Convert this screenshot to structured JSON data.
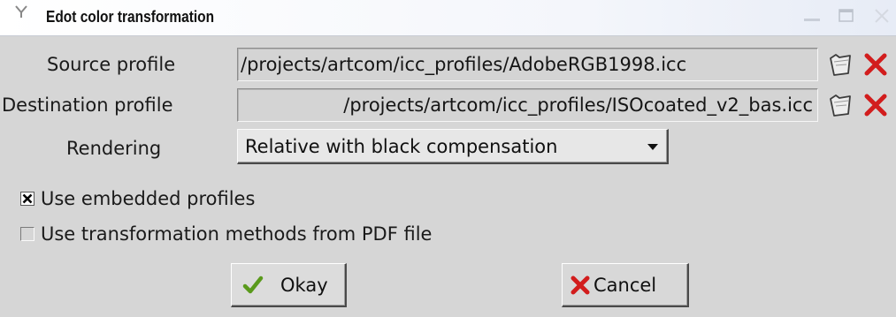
{
  "window": {
    "title": "Edot color transformation",
    "controls": [
      "window-menu-icon",
      "minimize-icon",
      "maximize-icon",
      "close-icon"
    ]
  },
  "source": {
    "label": "Source profile",
    "value": "/projects/artcom/icc_profiles/AdobeRGB1998.icc",
    "browse_icon": "folder-icon",
    "clear_icon": "red-x-icon"
  },
  "destination": {
    "label": "Destination profile",
    "value": "/projects/artcom/icc_profiles/ISOcoated_v2_bas.icc",
    "browse_icon": "folder-icon",
    "clear_icon": "red-x-icon"
  },
  "rendering": {
    "label": "Rendering",
    "selected": "Relative with black compensation"
  },
  "options": {
    "embedded": {
      "label": "Use embedded profiles",
      "checked": true
    },
    "pdf_methods": {
      "label": "Use transformation methods from PDF file",
      "checked": false
    }
  },
  "buttons": {
    "okay": {
      "label": "Okay",
      "icon": "green-check-icon"
    },
    "cancel": {
      "label": "Cancel",
      "icon": "red-x-icon"
    }
  },
  "colors": {
    "dialog_bg": "#d6d6d6",
    "check_green": "#5a9a1c",
    "cancel_red": "#d21d1d"
  }
}
